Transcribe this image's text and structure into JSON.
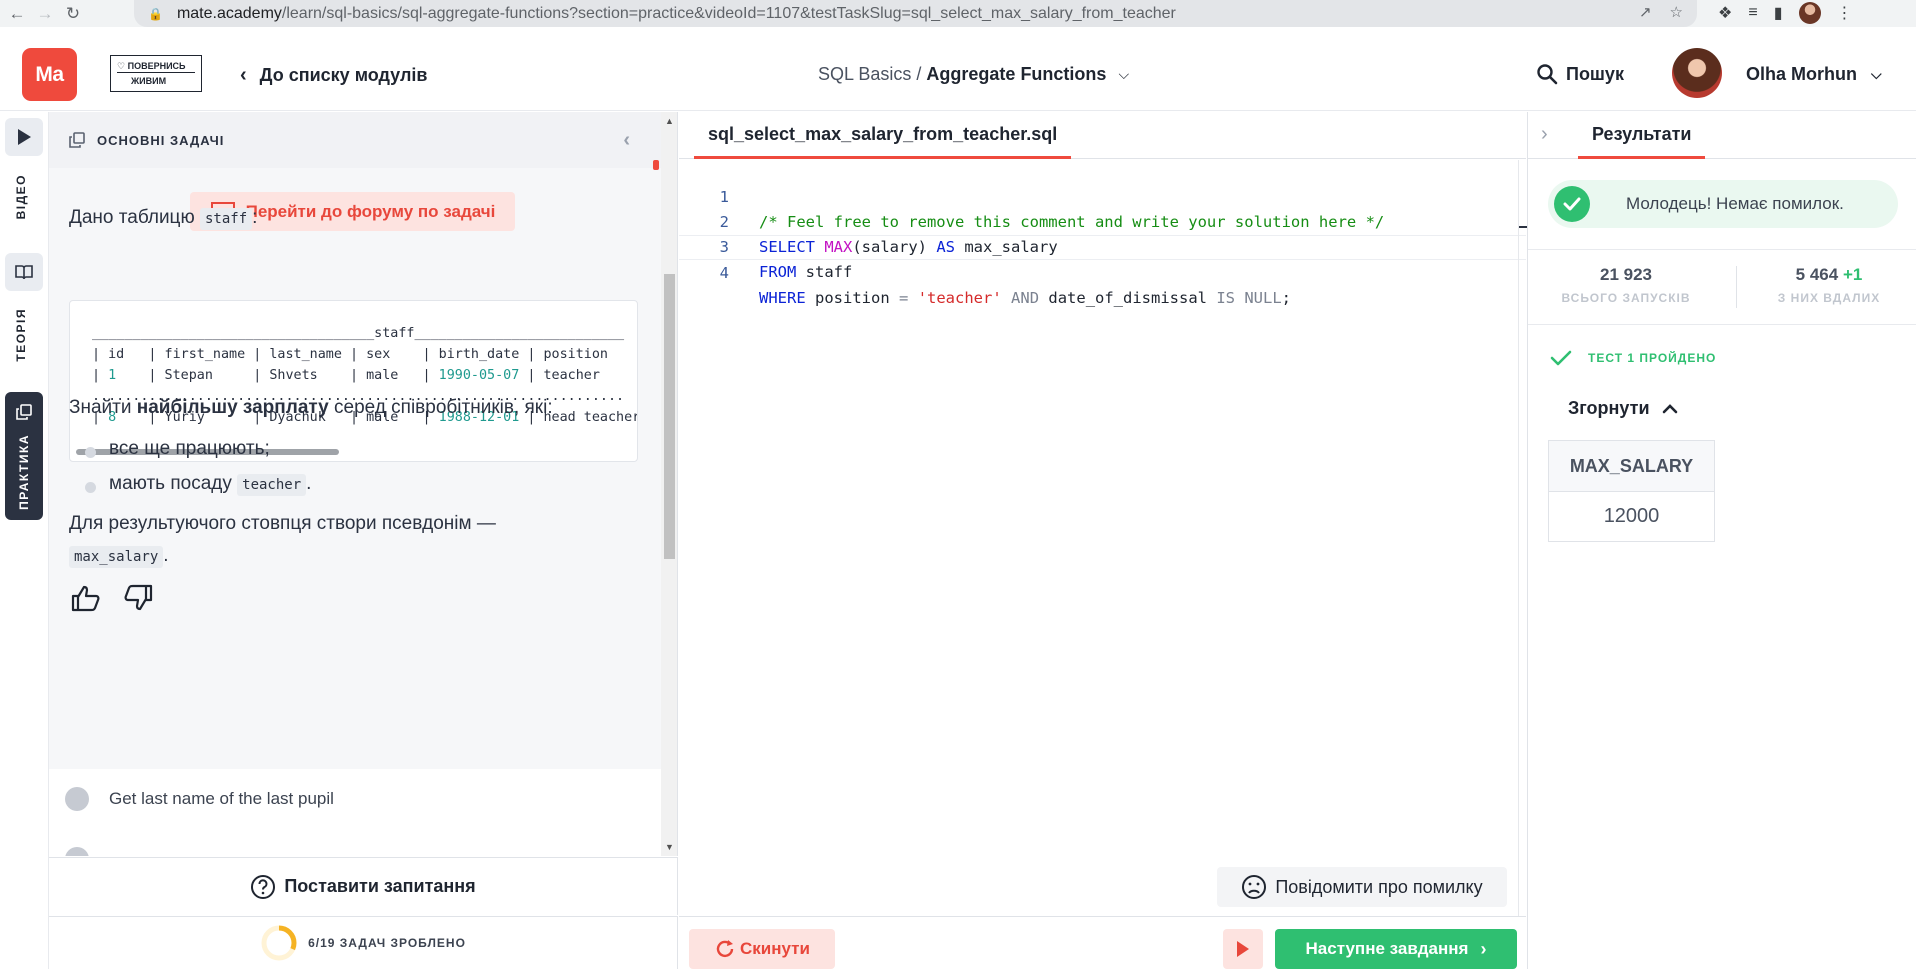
{
  "browser": {
    "url_host": "mate.academy",
    "url_path": "/learn/sql-basics/sql-aggregate-functions?section=practice&videoId=1107&testTaskSlug=sql_select_max_salary_from_teacher"
  },
  "header": {
    "logo_text": "Ma",
    "promo_line1": "ПОВЕРНИСЬ",
    "promo_line2": "ЖИВИМ",
    "back_label": "До списку модулів",
    "course": "SQL Basics",
    "separator": "/",
    "module": "Aggregate Functions",
    "search_label": "Пошук",
    "user_name": "Olha Morhun"
  },
  "rail": {
    "video_label": "ВІДЕО",
    "theory_label": "ТЕОРІЯ",
    "practice_label": "ПРАКТИКА"
  },
  "task": {
    "section_title": "ОСНОВНІ ЗАДАЧІ",
    "forum_label": "Перейти до форуму по задачі",
    "intro_text": "Дано таблицю",
    "intro_code": "staff",
    "intro_tail": ":",
    "ascii_title": "___________________________________staff__________________________",
    "ascii_header": "| id   | first_name | last_name | sex    | birth_date | position",
    "ascii_row1_a": "| ",
    "ascii_row1_id": "1",
    "ascii_row1_b": "    | Stepan     | Shvets    | male   | ",
    "ascii_row1_date": "1990-05-07",
    "ascii_row1_c": " | teacher",
    "ascii_dots": "..................................................................",
    "ascii_row2_a": "| ",
    "ascii_row2_id": "8",
    "ascii_row2_b": "    | Yuriy      | Dyachuk   | male   | ",
    "ascii_row2_date": "1988-12-01",
    "ascii_row2_c": " | head teacher",
    "goal_a": "Знайти ",
    "goal_bold": "найбільшу зарплату",
    "goal_b": " серед співробітників, які:",
    "bullet1": "все ще працюють;",
    "bullet2_text": "мають посаду",
    "bullet2_code": "teacher",
    "bullet2_tail": ".",
    "alias_text": "Для результуючого стовпця створи псевдонім —",
    "alias_code": "max_salary",
    "alias_tail": ".",
    "next_task": "Get last name of the last pupil",
    "ask_label": "Поставити запитання",
    "progress_label": "6/19 ЗАДАЧ ЗРОБЛЕНО",
    "progress_fraction": 0.316
  },
  "editor": {
    "tab_label": "sql_select_max_salary_from_teacher.sql",
    "lines": [
      {
        "n": "1",
        "comment": "/* Feel free to remove this comment and write your solution here */"
      },
      {
        "n": "2",
        "kw1": "SELECT ",
        "fn": "MAX",
        "t1": "(salary) ",
        "kw2": "AS",
        "t2": " max_salary"
      },
      {
        "n": "3",
        "kw1": "FROM",
        "t1": " staff"
      },
      {
        "n": "4",
        "kw1": "WHERE",
        "t1": " position ",
        "op1": "=",
        "t2": " ",
        "str": "'teacher'",
        "t3": " ",
        "op2": "AND",
        "t4": " date_of_dismissal ",
        "op3": "IS NULL",
        "t5": ";"
      }
    ],
    "report_label": "Повідомити про помилку",
    "reset_label": "Скинути",
    "next_label": "Наступне завдання"
  },
  "results": {
    "tab_label": "Результати",
    "success_msg": "Молодець! Немає помилок.",
    "runs_total": "21 923",
    "runs_total_label": "ВСЬОГО ЗАПУСКІВ",
    "runs_success": "5 464",
    "runs_success_delta": "+1",
    "runs_success_label": "З НИХ ВДАЛИХ",
    "test_label": "ТЕСТ 1 ПРОЙДЕНО",
    "collapse_label": "Згорнути",
    "column": "MAX_SALARY",
    "value": "12000"
  },
  "colors": {
    "brand_red": "#ef4a3d",
    "success_green": "#2fbf71"
  }
}
